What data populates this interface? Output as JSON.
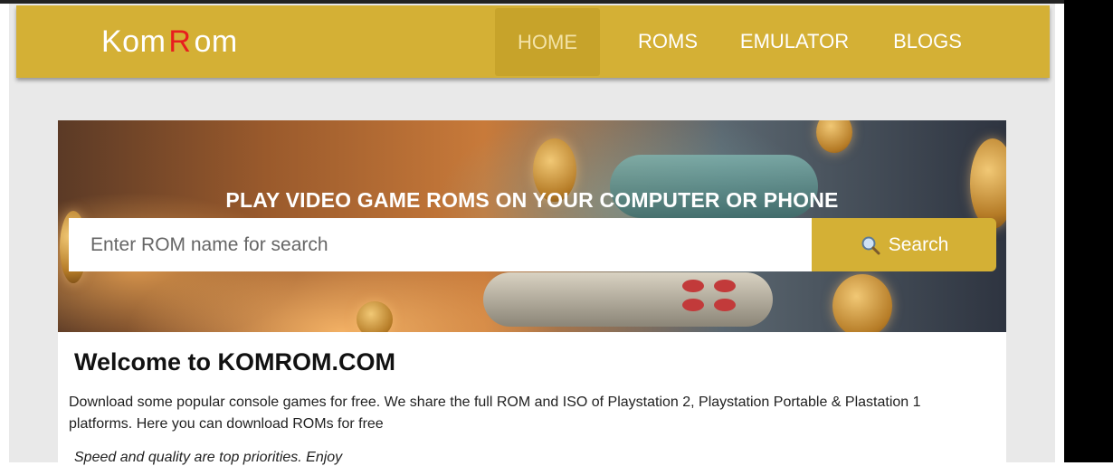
{
  "brand": {
    "logo_prefix": "Kom",
    "logo_highlight": "R",
    "logo_suffix": "om",
    "accent_color": "#d4b035",
    "highlight_color": "#e81e1e"
  },
  "nav": {
    "items": [
      {
        "label": "HOME",
        "active": true
      },
      {
        "label": "ROMS",
        "active": false
      },
      {
        "label": "EMULATOR",
        "active": false
      },
      {
        "label": "BLOGS",
        "active": false
      }
    ]
  },
  "hero": {
    "title": "PLAY VIDEO GAME ROMS ON YOUR COMPUTER OR PHONE",
    "search": {
      "placeholder": "Enter ROM name for search",
      "value": "",
      "button_label": "Search",
      "button_icon": "magnifier-icon"
    }
  },
  "content": {
    "heading": "Welcome to KOMROM.COM",
    "intro": "Download some popular console games for free. We share the full ROM and ISO of Playstation 2, Playstation Portable & Plastation 1 platforms. Here you can download ROMs for free",
    "tagline": "Speed and quality are top priorities. Enjoy"
  }
}
